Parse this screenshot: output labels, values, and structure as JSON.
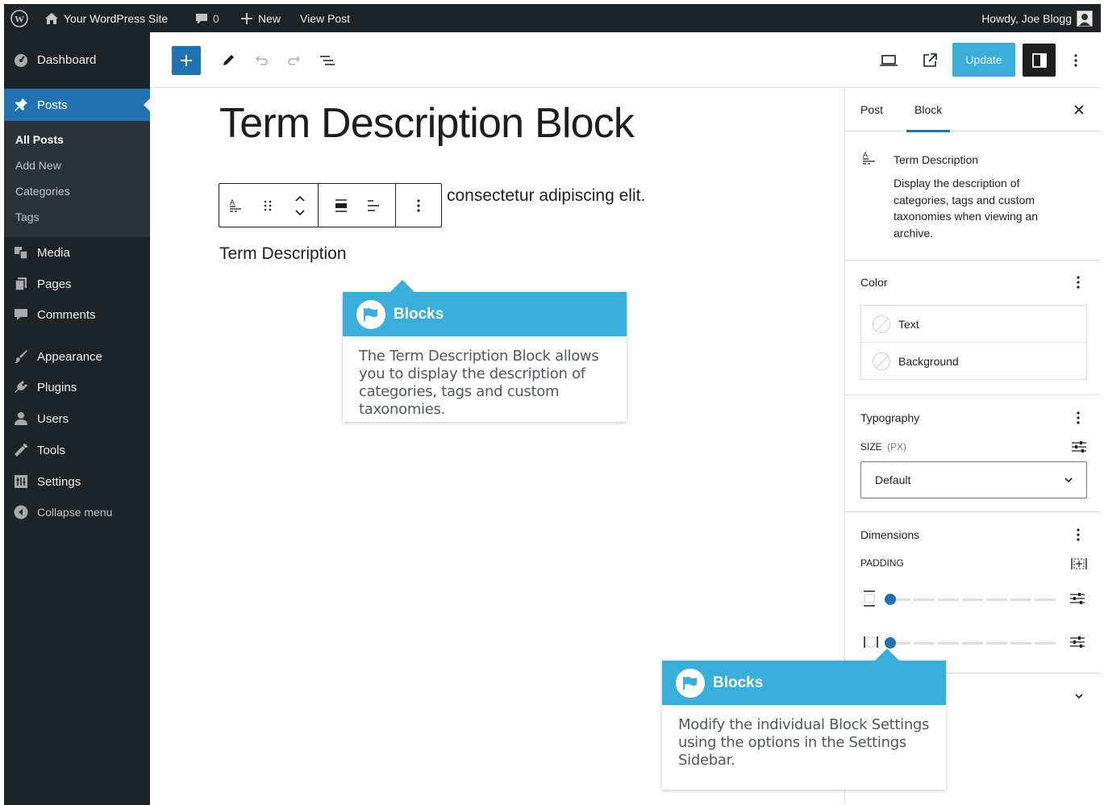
{
  "adminbar": {
    "site_name": "Your WordPress Site",
    "comments_count": "0",
    "new_label": "New",
    "view_post_label": "View Post",
    "howdy": "Howdy, Joe Blogg"
  },
  "menu": {
    "dashboard": "Dashboard",
    "posts": "Posts",
    "sub": [
      "All Posts",
      "Add New",
      "Categories",
      "Tags"
    ],
    "media": "Media",
    "pages": "Pages",
    "comments": "Comments",
    "appearance": "Appearance",
    "plugins": "Plugins",
    "users": "Users",
    "tools": "Tools",
    "settings": "Settings",
    "collapse": "Collapse menu"
  },
  "toolbar": {
    "update_label": "Update"
  },
  "editor": {
    "post_title": "Term Description Block",
    "paragraph_fragment": "consectetur adipiscing elit.",
    "block_placeholder": "Term Description"
  },
  "callout1": {
    "title": "Blocks",
    "body": "The Term Description Block allows you to display the description of categories, tags and custom taxonomies."
  },
  "callout2": {
    "title": "Blocks",
    "body": "Modify the individual Block Settings using the options in the Settings Sidebar."
  },
  "sidebar": {
    "tab_post": "Post",
    "tab_block": "Block",
    "block_name": "Term Description",
    "block_description": "Display the description of categories, tags and custom taxonomies when viewing an archive.",
    "color_title": "Color",
    "color_text": "Text",
    "color_background": "Background",
    "typography_title": "Typography",
    "size_label": "SIZE",
    "size_unit": "(PX)",
    "size_value": "Default",
    "dimensions_title": "Dimensions",
    "padding_label": "PADDING"
  },
  "colors": {
    "admin_dark": "#1d2327",
    "accent": "#2271b1",
    "callout_header": "#3aaed8"
  }
}
